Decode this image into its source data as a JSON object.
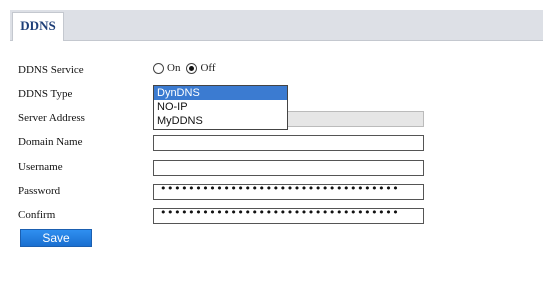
{
  "tabs": [
    {
      "label": "DDNS",
      "active": true
    }
  ],
  "form": {
    "ddns_service": {
      "label": "DDNS Service",
      "options": [
        "On",
        "Off"
      ],
      "selected": "Off"
    },
    "ddns_type": {
      "label": "DDNS Type",
      "options": [
        "DynDNS",
        "NO-IP",
        "MyDDNS"
      ],
      "selected": "DynDNS"
    },
    "server_address": {
      "label": "Server Address",
      "value": ""
    },
    "domain_name": {
      "label": "Domain Name",
      "value": ""
    },
    "username": {
      "label": "Username",
      "value": ""
    },
    "password": {
      "label": "Password",
      "masked": "••••••••••••••••••••••••••••••••••"
    },
    "confirm": {
      "label": "Confirm",
      "masked": "••••••••••••••••••••••••••••••••••"
    }
  },
  "buttons": {
    "save": "Save"
  },
  "colors": {
    "accent": "#1e3f78",
    "button": "#1a6fd0",
    "selected_option": "#3b7bd1"
  }
}
